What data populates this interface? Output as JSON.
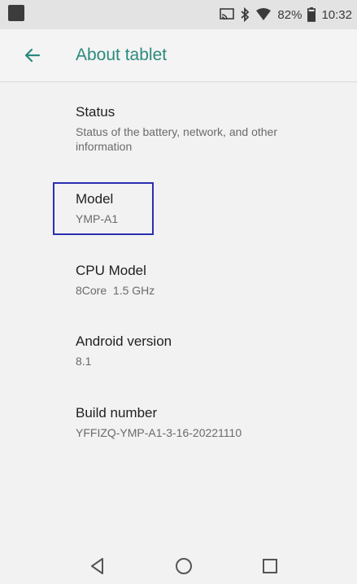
{
  "status_bar": {
    "battery_percent": "82%",
    "time": "10:32",
    "icons": [
      "screen-cast-icon",
      "bluetooth-icon",
      "wifi-icon",
      "battery-icon"
    ]
  },
  "app_bar": {
    "title": "About tablet",
    "back_icon": "back-arrow-icon",
    "accent_color": "#2a8a7c"
  },
  "items": [
    {
      "title": "Status",
      "subtitle": "Status of the battery, network, and other information"
    },
    {
      "title": "Model",
      "subtitle": "YMP-A1"
    },
    {
      "title": "CPU Model",
      "subtitle": "8Core  1.5 GHz"
    },
    {
      "title": "Android version",
      "subtitle": "8.1"
    },
    {
      "title": "Build number",
      "subtitle": "YFFIZQ-YMP-A1-3-16-20221110"
    }
  ],
  "nav_bar": {
    "icons": [
      "back-triangle-icon",
      "home-circle-icon",
      "recents-square-icon"
    ]
  }
}
